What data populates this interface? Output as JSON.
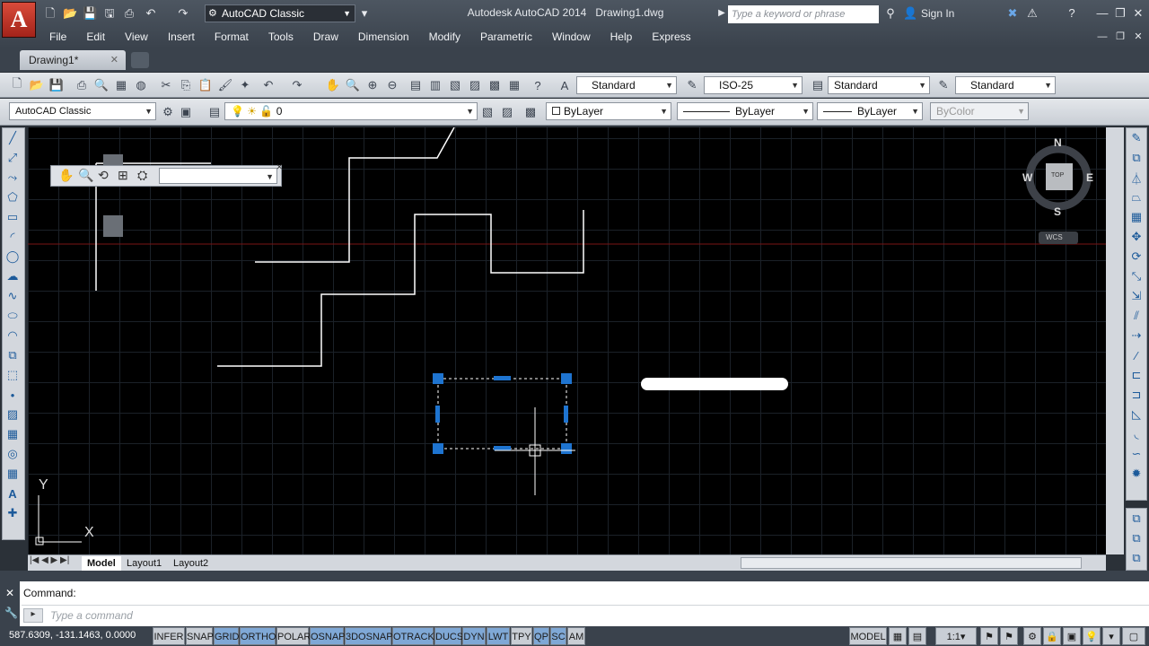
{
  "app": {
    "title": "Autodesk AutoCAD 2014",
    "filename": "Drawing1.dwg",
    "logo_letter": "A"
  },
  "workspace": {
    "value": "AutoCAD Classic"
  },
  "search": {
    "placeholder": "Type a keyword or phrase"
  },
  "user": {
    "sign_in": "Sign In"
  },
  "menu": [
    "File",
    "Edit",
    "View",
    "Insert",
    "Format",
    "Tools",
    "Draw",
    "Dimension",
    "Modify",
    "Parametric",
    "Window",
    "Help",
    "Express"
  ],
  "doc_tab": "Drawing1*",
  "styles": {
    "text_style": "Standard",
    "dim_style": "ISO-25",
    "table_style": "Standard",
    "mleader_style": "Standard"
  },
  "workspace2": "AutoCAD Classic",
  "layer": {
    "value": "0"
  },
  "properties": {
    "color": "ByLayer",
    "linetype": "ByLayer",
    "lineweight": "ByLayer",
    "plotstyle": "ByColor"
  },
  "viewcube": {
    "n": "N",
    "s": "S",
    "e": "E",
    "w": "W",
    "top": "TOP",
    "wcs": "WCS"
  },
  "ucs": {
    "x": "X",
    "y": "Y"
  },
  "layout_tabs": [
    "Model",
    "Layout1",
    "Layout2"
  ],
  "command": {
    "label": "Command:",
    "placeholder": "Type a command"
  },
  "status": {
    "coords": "587.6309, -131.1463, 0.0000",
    "toggles": [
      {
        "label": "INFER",
        "on": false
      },
      {
        "label": "SNAP",
        "on": false
      },
      {
        "label": "GRID",
        "on": true
      },
      {
        "label": "ORTHO",
        "on": true
      },
      {
        "label": "POLAR",
        "on": false
      },
      {
        "label": "OSNAP",
        "on": true
      },
      {
        "label": "3DOSNAP",
        "on": true
      },
      {
        "label": "OTRACK",
        "on": true
      },
      {
        "label": "DUCS",
        "on": true
      },
      {
        "label": "DYN",
        "on": true
      },
      {
        "label": "LWT",
        "on": true
      },
      {
        "label": "TPY",
        "on": false
      },
      {
        "label": "QP",
        "on": true
      },
      {
        "label": "SC",
        "on": true
      },
      {
        "label": "AM",
        "on": false
      }
    ],
    "model": "MODEL",
    "scale": "1:1"
  },
  "colors": {
    "accent": "#7fa8d6",
    "grip": "#1e74d0",
    "canvas": "#000000",
    "logo": "#c0392b"
  }
}
